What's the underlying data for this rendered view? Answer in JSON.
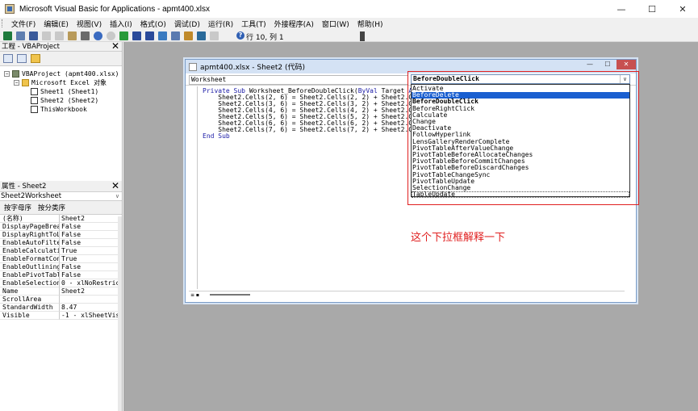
{
  "window": {
    "title": "Microsoft Visual Basic for Applications - apmt400.xlsx",
    "controls": {
      "minimize": "—",
      "maximize": "☐",
      "close": "✕"
    }
  },
  "menu": [
    "文件(F)",
    "编辑(E)",
    "视图(V)",
    "插入(I)",
    "格式(O)",
    "调试(D)",
    "运行(R)",
    "工具(T)",
    "外接程序(A)",
    "窗口(W)",
    "帮助(H)"
  ],
  "toolbar": {
    "status": "行 10, 列 1",
    "help_glyph": "?",
    "icons": [
      "excel-icon",
      "insert-icon",
      "save-icon",
      "cut-icon",
      "copy-icon",
      "paste-icon",
      "find-icon",
      "undo-icon",
      "redo-icon",
      "run-icon",
      "break-icon",
      "reset-icon",
      "design-mode-icon",
      "project-explorer-icon",
      "properties-icon",
      "object-browser-icon",
      "toolbox-icon"
    ]
  },
  "colors": {
    "accent_selection": "#1a5fd0",
    "annotation_red": "#e02020",
    "keyword_blue": "#1a1aa6",
    "mdi_gray": "#a9a9a9"
  },
  "project_panel": {
    "title": "工程 - VBAProject",
    "close": "✕",
    "tree": [
      {
        "label": "VBAProject (apmt400.xlsx)",
        "level": 0,
        "expander": "−"
      },
      {
        "label": "Microsoft Excel 对象",
        "level": 1,
        "expander": "−"
      },
      {
        "label": "Sheet1 (Sheet1)",
        "level": 2
      },
      {
        "label": "Sheet2 (Sheet2)",
        "level": 2
      },
      {
        "label": "ThisWorkbook",
        "level": 2
      }
    ]
  },
  "properties_panel": {
    "title": "属性 - Sheet2",
    "close": "✕",
    "object_name": "Sheet2",
    "object_type": "Worksheet",
    "tabs": [
      "按字母序",
      "按分类序"
    ],
    "rows": [
      {
        "k": "(名称)",
        "v": "Sheet2"
      },
      {
        "k": "DisplayPageBreak",
        "v": "False"
      },
      {
        "k": "DisplayRightToLe",
        "v": "False"
      },
      {
        "k": "EnableAutoFilter",
        "v": "False"
      },
      {
        "k": "EnableCalculatio",
        "v": "True"
      },
      {
        "k": "EnableFormatCond",
        "v": "True"
      },
      {
        "k": "EnableOutlining",
        "v": "False"
      },
      {
        "k": "EnablePivotTable",
        "v": "False"
      },
      {
        "k": "EnableSelection",
        "v": "0 - xlNoRestrict"
      },
      {
        "k": "Name",
        "v": "Sheet2"
      },
      {
        "k": "ScrollArea",
        "v": ""
      },
      {
        "k": "StandardWidth",
        "v": "8.47"
      },
      {
        "k": "Visible",
        "v": "-1 - xlSheetVisi"
      }
    ]
  },
  "code_window": {
    "title": "apmt400.xlsx - Sheet2 (代码)",
    "object_combo": "Worksheet",
    "procedure_combo": "BeforeDoubleClick",
    "lines": [
      "Private Sub Worksheet_BeforeDoubleClick(ByVal Target As Range, B",
      "    Sheet2.Cells(2, 6) = Sheet2.Cells(2, 2) + Sheet2.Cells(2, 3",
      "    Sheet2.Cells(3, 6) = Sheet2.Cells(3, 2) + Sheet2.Cells(3, 3",
      "    Sheet2.Cells(4, 6) = Sheet2.Cells(4, 2) + Sheet2.Cells(4, 3",
      "    Sheet2.Cells(5, 6) = Sheet2.Cells(5, 2) + Sheet2.Cells(5, 3",
      "    Sheet2.Cells(6, 6) = Sheet2.Cells(6, 2) + Sheet2.Cells(6, 3",
      "    Sheet2.Cells(7, 6) = Sheet2.Cells(7, 2) + Sheet2.Cells(7, 3",
      "End Sub"
    ]
  },
  "event_dropdown": {
    "items": [
      {
        "label": "Activate"
      },
      {
        "label": "BeforeDelete",
        "selected": true
      },
      {
        "label": "BeforeDoubleClick",
        "bold": true
      },
      {
        "label": "BeforeRightClick"
      },
      {
        "label": "Calculate"
      },
      {
        "label": "Change"
      },
      {
        "label": "Deactivate"
      },
      {
        "label": "FollowHyperlink"
      },
      {
        "label": "LensGalleryRenderComplete"
      },
      {
        "label": "PivotTableAfterValueChange"
      },
      {
        "label": "PivotTableBeforeAllocateChanges"
      },
      {
        "label": "PivotTableBeforeCommitChanges"
      },
      {
        "label": "PivotTableBeforeDiscardChanges"
      },
      {
        "label": "PivotTableChangeSync"
      },
      {
        "label": "PivotTableUpdate"
      },
      {
        "label": "SelectionChange"
      },
      {
        "label": "TableUpdate",
        "dotted": true
      }
    ]
  },
  "annotation": {
    "text": "这个下拉框解释一下"
  }
}
